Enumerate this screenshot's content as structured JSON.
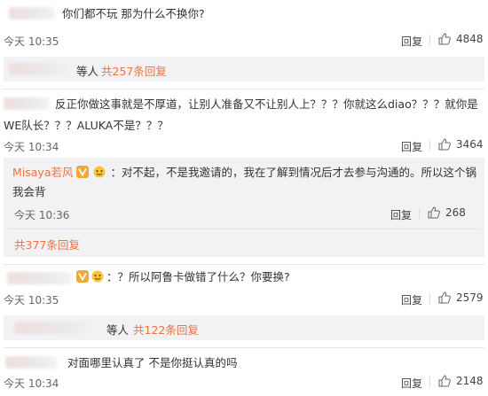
{
  "comments": [
    {
      "text": "你们都不玩 那为什么不换你?",
      "time": "今天 10:35",
      "reply": "回复",
      "likes": "4848"
    },
    {
      "summary_suffix": "等人",
      "summary_count": "共257条回复"
    },
    {
      "text_line1": "反正你做这事就是不厚道，让别人准备又不让别人上？？？你就这么diao？？？就你是",
      "text_line2": "WE队长？？？ALUKA不是？？？",
      "time": "今天 10:34",
      "reply": "回复",
      "likes": "3464"
    },
    {
      "user": "Misaya若风",
      "text_line1": "：对不起，不是我邀请的，我在了解到情况后才去参与沟通的。所以这个锅",
      "text_line2": "我会背",
      "time": "今天 10:36",
      "reply": "回复",
      "likes": "268"
    },
    {
      "total": "共377条回复"
    },
    {
      "text": "：？所以阿鲁卡做错了什么？你要换?",
      "time": "今天 10:35",
      "reply": "回复",
      "likes": "2579"
    },
    {
      "summary_suffix": "等人",
      "summary_count": "共122条回复"
    },
    {
      "text": "对面哪里认真了 不是你挺认真的吗",
      "time": "今天 10:34",
      "reply": "回复",
      "likes": "2148"
    }
  ],
  "colors": {
    "link": "#eb7340",
    "divider": "#e6e6e6",
    "subbox": "#f2f2f5"
  },
  "icons": [
    "thumb-up-icon",
    "vip-badge-icon",
    "emoji-icon"
  ]
}
